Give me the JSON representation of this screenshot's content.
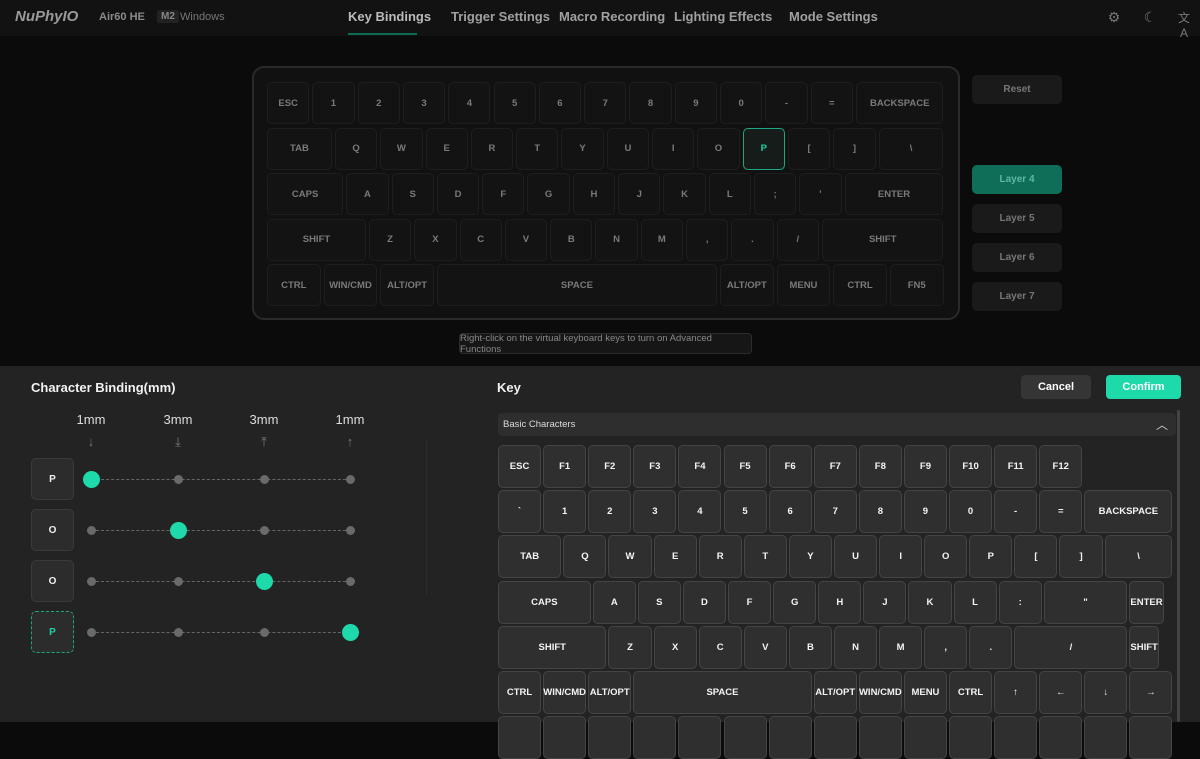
{
  "header": {
    "logo": "NuPhyIO",
    "model": "Air60 HE",
    "badge": "M2",
    "os": "Windows",
    "tabs": [
      {
        "label": "Key Bindings",
        "active": true
      },
      {
        "label": "Trigger Settings"
      },
      {
        "label": "Macro Recording"
      },
      {
        "label": "Lighting Effects"
      },
      {
        "label": "Mode Settings"
      }
    ],
    "icons": [
      "gear-icon",
      "moon-icon",
      "translate-icon"
    ]
  },
  "virtual_keyboard": {
    "selected_key": "P",
    "accent": "#1aa882",
    "rows": [
      [
        "ESC",
        "1",
        "2",
        "3",
        "4",
        "5",
        "6",
        "7",
        "8",
        "9",
        "0",
        "-",
        "=",
        "BACKSPACE"
      ],
      [
        "TAB",
        "Q",
        "W",
        "E",
        "R",
        "T",
        "Y",
        "U",
        "I",
        "O",
        "P",
        "[",
        "]",
        "\\"
      ],
      [
        "CAPS",
        "A",
        "S",
        "D",
        "F",
        "G",
        "H",
        "J",
        "K",
        "L",
        ";",
        "'",
        "ENTER"
      ],
      [
        "SHIFT",
        "Z",
        "X",
        "C",
        "V",
        "B",
        "N",
        "M",
        ",",
        ".",
        "/",
        "SHIFT"
      ],
      [
        "CTRL",
        "WIN/CMD",
        "ALT/OPT",
        "SPACE",
        "ALT/OPT",
        "MENU",
        "CTRL",
        "FN5"
      ]
    ]
  },
  "side": {
    "reset": "Reset",
    "layers": [
      "Layer 4",
      "Layer 5",
      "Layer 6",
      "Layer 7"
    ],
    "active_layer": "Layer 4"
  },
  "hint": "Right-click on the virtual keyboard keys to turn on Advanced Functions",
  "binding": {
    "title": "Character Binding(mm)",
    "columns": [
      {
        "label": "1mm",
        "icon": "arrow-down-icon",
        "glyph": "↓"
      },
      {
        "label": "3mm",
        "icon": "arrow-down-bar-icon",
        "glyph": "⤓"
      },
      {
        "label": "3mm",
        "icon": "arrow-up-bar-icon",
        "glyph": "⤒"
      },
      {
        "label": "1mm",
        "icon": "arrow-up-icon",
        "glyph": "↑"
      }
    ],
    "rows": [
      {
        "key": "P",
        "active_column": 0
      },
      {
        "key": "O",
        "active_column": 1
      },
      {
        "key": "O",
        "active_column": 2
      },
      {
        "key": "P",
        "active_column": 3,
        "selected": true
      }
    ]
  },
  "key_panel": {
    "title": "Key",
    "cancel": "Cancel",
    "confirm": "Confirm",
    "section": "Basic Characters",
    "accent": "#1ed9aa",
    "rows": [
      [
        "ESC",
        "F1",
        "F2",
        "F3",
        "F4",
        "F5",
        "F6",
        "F7",
        "F8",
        "F9",
        "F10",
        "F11",
        "F12"
      ],
      [
        "`",
        "1",
        "2",
        "3",
        "4",
        "5",
        "6",
        "7",
        "8",
        "9",
        "0",
        "-",
        "=",
        "BACKSPACE"
      ],
      [
        "TAB",
        "Q",
        "W",
        "E",
        "R",
        "T",
        "Y",
        "U",
        "I",
        "O",
        "P",
        "[",
        "]",
        "\\"
      ],
      [
        "CAPS",
        "A",
        "S",
        "D",
        "F",
        "G",
        "H",
        "J",
        "K",
        "L",
        ":",
        "\"",
        "ENTER"
      ],
      [
        "SHIFT",
        "Z",
        "X",
        "C",
        "V",
        "B",
        "N",
        "M",
        ",",
        ".",
        "/",
        "SHIFT"
      ],
      [
        "CTRL",
        "WIN/CMD",
        "ALT/OPT",
        "SPACE",
        "ALT/OPT",
        "WIN/CMD",
        "MENU",
        "CTRL",
        "↑",
        "←",
        "↓",
        "→"
      ]
    ]
  }
}
